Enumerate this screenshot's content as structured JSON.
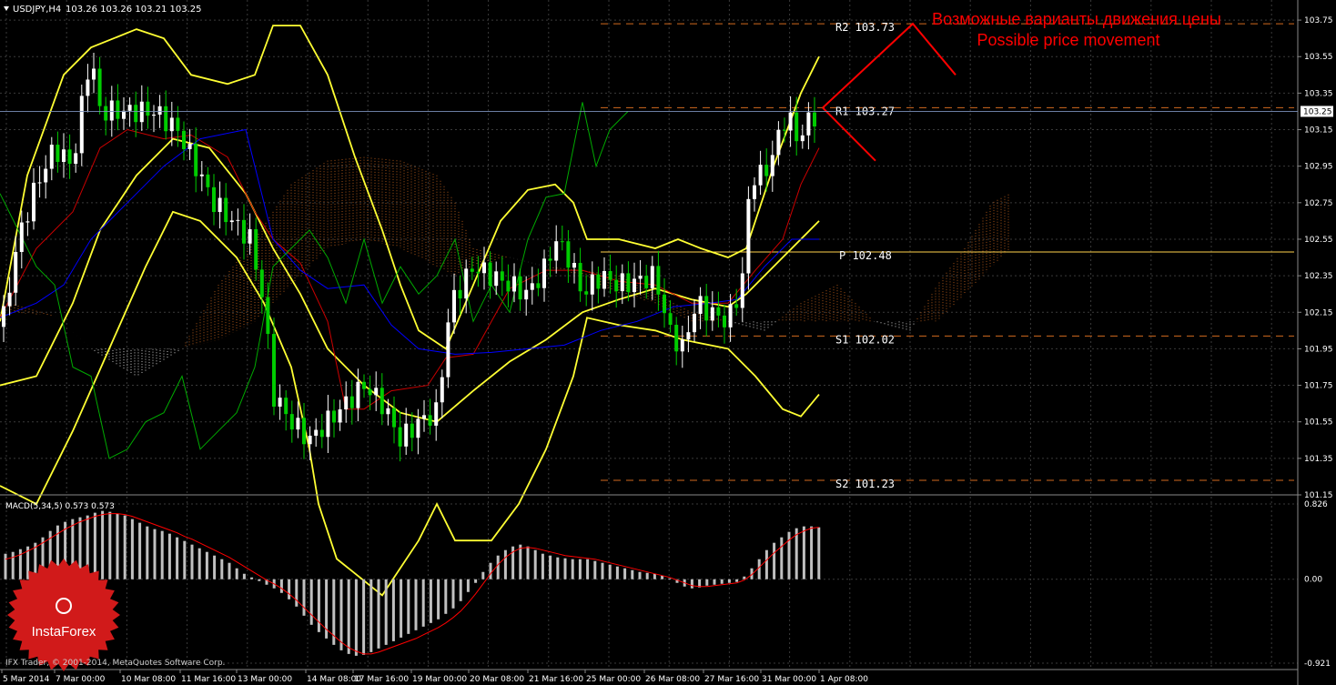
{
  "header": {
    "symbol": "USDJPY,H4",
    "quotes": "103.26 103.26 103.21 103.25"
  },
  "annotation": {
    "line1": "Возможные варианты движения цены",
    "line2": "Possible price movement",
    "color": "#ff0000"
  },
  "colors": {
    "background": "#000000",
    "grid": "#3a3a3a",
    "bull": "#ffffff",
    "bear": "#00cc00",
    "bollinger": "#ffff33",
    "kijun": "#cc0000",
    "tenkan": "#0000ff",
    "chikou": "#00aa00",
    "senkou_a": "#d2691e",
    "senkou_b": "#ffffff",
    "pivot_lines": "#d2691e",
    "pivot_main": "#ffd24d",
    "macd_hist": "#c0c0c0",
    "macd_signal": "#ff0000"
  },
  "chart_data": [
    {
      "type": "candlestick",
      "title": "USDJPY,H4",
      "ylim": [
        101.15,
        103.86
      ],
      "y_ticks": [
        "103.75",
        "103.55",
        "103.35",
        "103.15",
        "102.95",
        "102.75",
        "102.55",
        "102.35",
        "102.15",
        "101.95",
        "101.75",
        "101.55",
        "101.35",
        "101.15"
      ],
      "current_price": "103.25",
      "x_ticks": [
        "5 Mar 2014",
        "7 Mar 00:00",
        "10 Mar 08:00",
        "11 Mar 16:00",
        "13 Mar 00:00",
        "14 Mar 08:00",
        "17 Mar 16:00",
        "19 Mar 00:00",
        "20 Mar 08:00",
        "21 Mar 16:00",
        "25 Mar 00:00",
        "26 Mar 08:00",
        "27 Mar 16:00",
        "31 Mar 00:00",
        "1 Apr 08:00"
      ],
      "pivot_levels": [
        {
          "label": "R2 103.73",
          "value": 103.73
        },
        {
          "label": "R1 103.27",
          "value": 103.27
        },
        {
          "label": "P 102.48",
          "value": 102.48
        },
        {
          "label": "S1 102.02",
          "value": 102.02
        },
        {
          "label": "S2 101.23",
          "value": 101.23
        }
      ],
      "forecast": {
        "up_path": [
          [
            "1 Apr 08:00",
            103.27
          ],
          [
            "R2",
            103.73
          ]
        ],
        "after_up": [
          [
            "R2",
            103.73
          ],
          [
            "end",
            103.45
          ]
        ],
        "down_path": [
          [
            "1 Apr 08:00",
            103.27
          ],
          [
            "end",
            102.98
          ]
        ]
      }
    },
    {
      "type": "bar",
      "title": "MACD(5,34,5)",
      "readout": "MACD(5,34,5) 0.573 0.573",
      "ylim": [
        -0.921,
        0.826
      ],
      "y_ticks": [
        "0.826",
        "0.00",
        "-0.921"
      ],
      "histogram": [
        0.28,
        0.3,
        0.33,
        0.36,
        0.4,
        0.46,
        0.53,
        0.59,
        0.63,
        0.66,
        0.68,
        0.7,
        0.73,
        0.75,
        0.74,
        0.72,
        0.7,
        0.66,
        0.62,
        0.58,
        0.55,
        0.53,
        0.5,
        0.46,
        0.42,
        0.38,
        0.34,
        0.3,
        0.26,
        0.22,
        0.18,
        0.12,
        0.06,
        0.02,
        -0.02,
        -0.06,
        -0.1,
        -0.15,
        -0.22,
        -0.3,
        -0.4,
        -0.5,
        -0.58,
        -0.65,
        -0.72,
        -0.78,
        -0.82,
        -0.84,
        -0.83,
        -0.8,
        -0.76,
        -0.72,
        -0.68,
        -0.64,
        -0.6,
        -0.56,
        -0.52,
        -0.48,
        -0.44,
        -0.38,
        -0.32,
        -0.24,
        -0.14,
        -0.04,
        0.08,
        0.18,
        0.26,
        0.32,
        0.36,
        0.38,
        0.36,
        0.32,
        0.28,
        0.26,
        0.24,
        0.23,
        0.22,
        0.22,
        0.22,
        0.2,
        0.18,
        0.16,
        0.14,
        0.12,
        0.1,
        0.08,
        0.07,
        0.06,
        0.04,
        0.01,
        -0.04,
        -0.08,
        -0.1,
        -0.09,
        -0.07,
        -0.06,
        -0.05,
        -0.04,
        -0.03,
        0.03,
        0.12,
        0.22,
        0.32,
        0.4,
        0.46,
        0.52,
        0.56,
        0.58,
        0.58,
        0.57
      ],
      "signal": [
        0.22,
        0.24,
        0.27,
        0.31,
        0.35,
        0.4,
        0.45,
        0.5,
        0.55,
        0.59,
        0.63,
        0.66,
        0.69,
        0.71,
        0.72,
        0.72,
        0.71,
        0.69,
        0.66,
        0.63,
        0.6,
        0.57,
        0.54,
        0.51,
        0.47,
        0.44,
        0.4,
        0.36,
        0.32,
        0.28,
        0.24,
        0.19,
        0.14,
        0.09,
        0.04,
        -0.01,
        -0.05,
        -0.1,
        -0.16,
        -0.23,
        -0.31,
        -0.39,
        -0.47,
        -0.55,
        -0.62,
        -0.69,
        -0.75,
        -0.79,
        -0.82,
        -0.82,
        -0.8,
        -0.77,
        -0.74,
        -0.71,
        -0.68,
        -0.65,
        -0.61,
        -0.57,
        -0.53,
        -0.48,
        -0.42,
        -0.35,
        -0.26,
        -0.16,
        -0.05,
        0.06,
        0.16,
        0.24,
        0.3,
        0.34,
        0.35,
        0.34,
        0.32,
        0.3,
        0.28,
        0.26,
        0.25,
        0.24,
        0.23,
        0.22,
        0.2,
        0.18,
        0.16,
        0.14,
        0.12,
        0.1,
        0.08,
        0.06,
        0.04,
        0.02,
        -0.01,
        -0.04,
        -0.07,
        -0.08,
        -0.08,
        -0.07,
        -0.06,
        -0.05,
        -0.04,
        -0.01,
        0.05,
        0.13,
        0.21,
        0.29,
        0.36,
        0.43,
        0.49,
        0.53,
        0.56,
        0.57
      ]
    }
  ],
  "footer": {
    "copyright": "IFX Trader, © 2001-2014, MetaQuotes Software Corp.",
    "logo_text": "InstaForex"
  }
}
